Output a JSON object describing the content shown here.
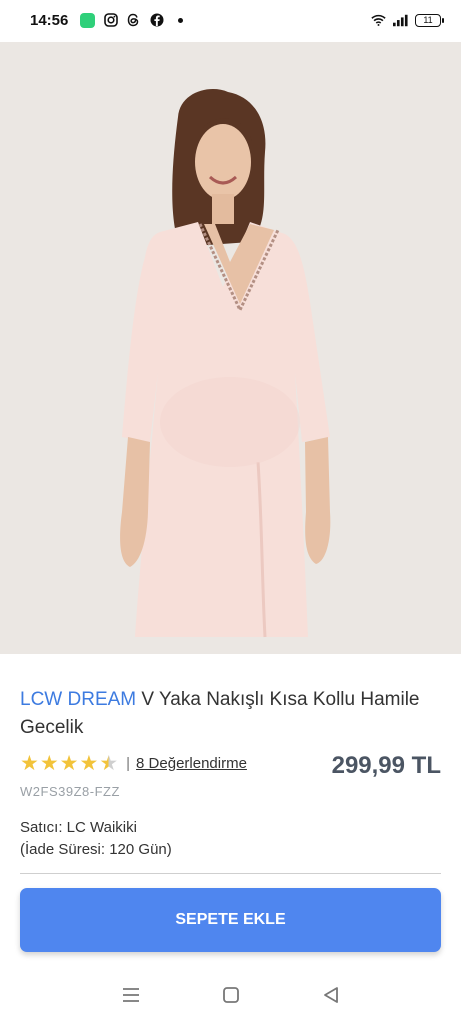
{
  "status": {
    "time": "14:56",
    "battery": "11"
  },
  "product": {
    "brand": "LCW DREAM",
    "title_rest": "V Yaka Nakışlı Kısa Kollu Hamile Gecelik",
    "rating": 4.5,
    "reviews_label": "8 Değerlendirme",
    "price": "299,99 TL",
    "sku": "W2FS39Z8-FZZ",
    "seller_line": "Satıcı: LC Waikiki",
    "return_line": "(İade Süresi: 120 Gün)"
  },
  "actions": {
    "add_to_cart": "SEPETE EKLE"
  },
  "nav": {
    "icons": [
      "menu-icon",
      "home-square-icon",
      "back-triangle-icon"
    ]
  }
}
